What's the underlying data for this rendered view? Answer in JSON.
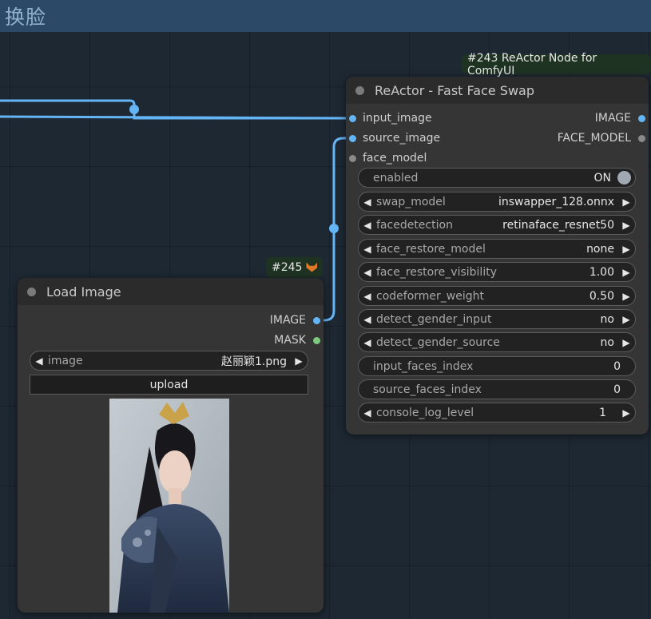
{
  "group": {
    "title": "换脸"
  },
  "reactor_node": {
    "badge": "#243 ReActor Node for ComfyUI",
    "title": "ReActor - Fast Face Swap",
    "inputs": [
      {
        "name": "input_image"
      },
      {
        "name": "source_image"
      },
      {
        "name": "face_model"
      }
    ],
    "outputs": [
      {
        "name": "IMAGE"
      },
      {
        "name": "FACE_MODEL"
      }
    ],
    "widgets": {
      "enabled": {
        "label": "enabled",
        "value": "ON"
      },
      "swap_model": {
        "label": "swap_model",
        "value": "inswapper_128.onnx"
      },
      "facedetection": {
        "label": "facedetection",
        "value": "retinaface_resnet50"
      },
      "face_restore_model": {
        "label": "face_restore_model",
        "value": "none"
      },
      "face_restore_visibility": {
        "label": "face_restore_visibility",
        "value": "1.00"
      },
      "codeformer_weight": {
        "label": "codeformer_weight",
        "value": "0.50"
      },
      "detect_gender_input": {
        "label": "detect_gender_input",
        "value": "no"
      },
      "detect_gender_source": {
        "label": "detect_gender_source",
        "value": "no"
      },
      "input_faces_index": {
        "label": "input_faces_index",
        "value": "0"
      },
      "source_faces_index": {
        "label": "source_faces_index",
        "value": "0"
      },
      "console_log_level": {
        "label": "console_log_level",
        "value": "1"
      }
    }
  },
  "load_image_node": {
    "badge": "#245",
    "title": "Load Image",
    "outputs": [
      {
        "name": "IMAGE"
      },
      {
        "name": "MASK"
      }
    ],
    "image_widget": {
      "label": "image",
      "value": "赵丽颖1.png"
    },
    "upload_label": "upload"
  },
  "colors": {
    "link": "#64b5f6",
    "group_header": "#2c4a68",
    "node_body": "#353535",
    "node_title": "#2b2b2b"
  }
}
